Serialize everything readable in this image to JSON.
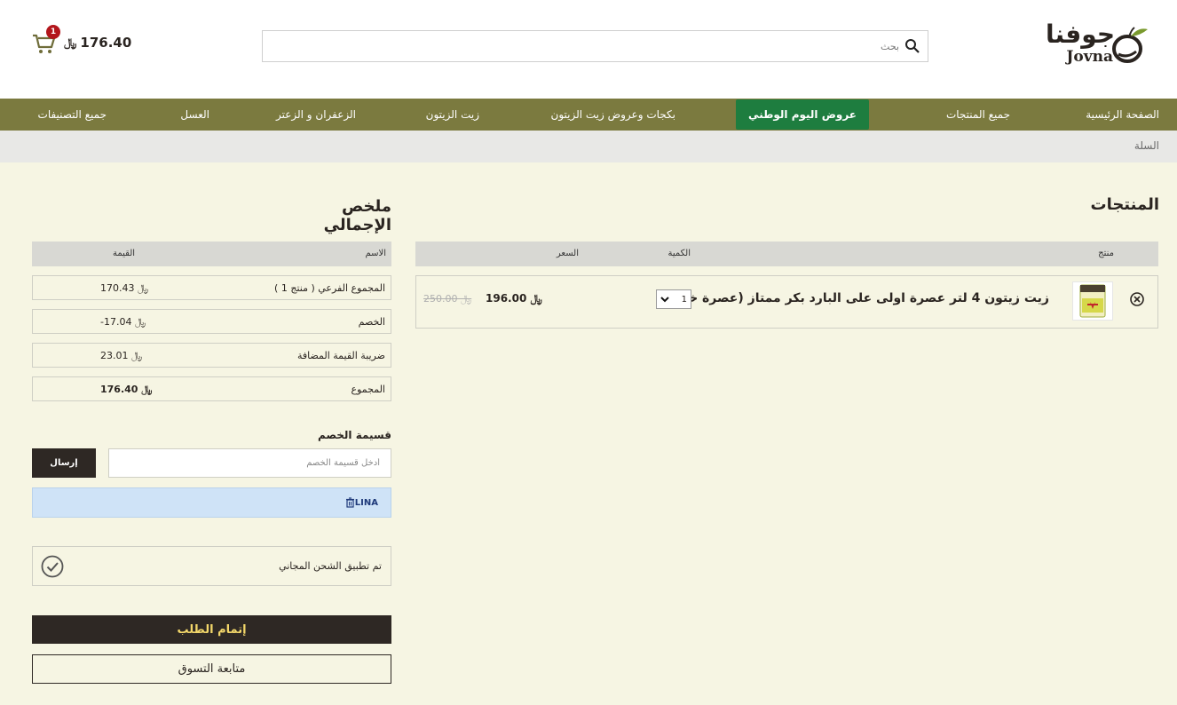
{
  "brand": {
    "name_ar": "جوفنا",
    "name_en": "Jovna"
  },
  "search": {
    "placeholder": "بحث"
  },
  "cart": {
    "count": "1",
    "total": "176.40",
    "currency": "﷼"
  },
  "nav": {
    "items": [
      {
        "label": "الصفحة الرئيسية"
      },
      {
        "label": "جميع المنتجات"
      },
      {
        "label": "عروض اليوم الوطني"
      },
      {
        "label": "بكجات وعروض زيت الزيتون"
      },
      {
        "label": "زيت الزيتون"
      },
      {
        "label": "الزعفران و الزعتر"
      },
      {
        "label": "العسل"
      },
      {
        "label": "جميع التصنيفات"
      }
    ],
    "active_color": "#1e7d3f",
    "bar_color": "#7b7a3f"
  },
  "breadcrumb": {
    "current": "السلة"
  },
  "products": {
    "title": "المنتجات",
    "headers": {
      "product": "منتج",
      "quantity": "الكمية",
      "price": "السعر"
    },
    "items": [
      {
        "name": "زيت زيتون 4 لتر عصرة اولى على البارد بكر ممتاز (عصرة خاصة)",
        "quantity": "1",
        "price": "196.00 ﷼",
        "old_price": "250.00 ﷼"
      }
    ]
  },
  "summary": {
    "title": "ملخص الإجمالي",
    "headers": {
      "name": "الاسم",
      "value": "القيمة"
    },
    "rows": [
      {
        "label": "المجموع الفرعي ( منتج 1 )",
        "value": "170.43 ﷼"
      },
      {
        "label": "الخصم",
        "value": "-17.04 ﷼"
      },
      {
        "label": "ضريبة القيمة المضافة",
        "value": "23.01 ﷼"
      },
      {
        "label": "المجموع",
        "value": "176.40 ﷼"
      }
    ]
  },
  "coupon": {
    "title": "قسيمة الخصم",
    "placeholder": "أدخل قسيمة الخصم",
    "submit": "إرسال",
    "applied_code": "LINA"
  },
  "shipping": {
    "message": "تم تطبيق الشحن المجاني"
  },
  "actions": {
    "checkout": "إتمام الطلب",
    "continue": "متابعة التسوق"
  }
}
